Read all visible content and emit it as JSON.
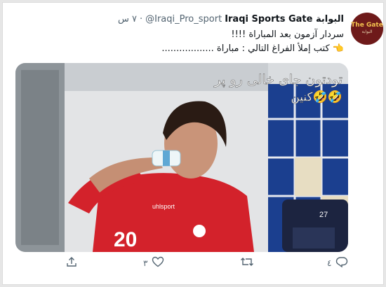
{
  "tweet": {
    "display_name": "Iraqi Sports Gate البوابة",
    "handle": "@Iraqi_Pro_sport",
    "separator": "·",
    "time": "٧ س",
    "text_line_1": "سردار آزمون بعد المباراة !!!!",
    "text_line_2_icon": "👈",
    "text_line_2": "كتب إملأ الفراغ التالي : مباراة ..................",
    "avatar": {
      "logo_text": "The Gate",
      "logo_subtext": "البوابة"
    }
  },
  "media": {
    "overlay_text_line_1": "تودتون جای خالی رو پر",
    "overlay_text_line_2": "کنین🤣🤣",
    "jersey_number": "20",
    "bag_number": "27",
    "brand_text": "uhlsport"
  },
  "actions": {
    "reply_count": "٤",
    "retweet_count": "",
    "like_count": "٣",
    "share_count": ""
  },
  "colors": {
    "accent": "#1d9bf0",
    "text": "#0f1419",
    "muted": "#536471",
    "jersey_red": "#d3222b"
  }
}
